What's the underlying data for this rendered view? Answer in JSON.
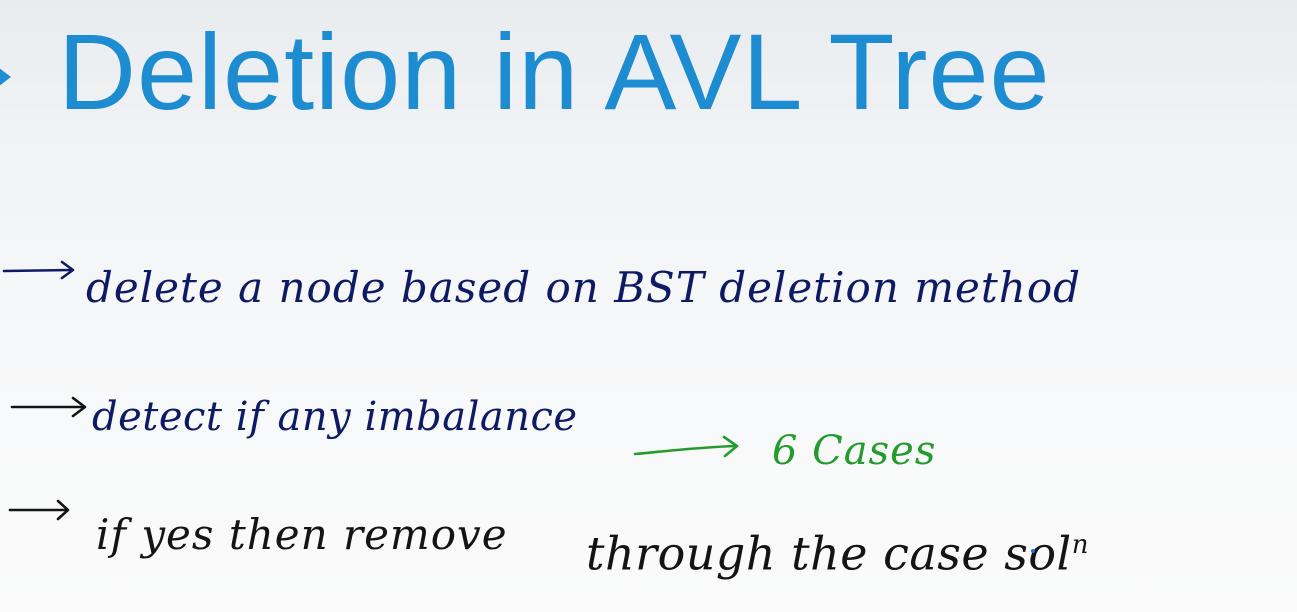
{
  "slide": {
    "title": "Deletion in AVL Tree",
    "title_color": "#1d8cd0",
    "bullet_marker": "triangle-right-icon"
  },
  "notes": [
    {
      "text": "delete  a node  based on  BST deletion  method",
      "color": "#0e1a63"
    },
    {
      "text": "detect  if  any  imbalance",
      "color": "#0e1a63"
    },
    {
      "text": "if  yes  then  remove",
      "color": "#141414"
    }
  ],
  "annotation": {
    "cases_text": "6  Cases",
    "color": "#249b2f"
  },
  "solution_note": {
    "text": "through the case sol",
    "superscript": "n",
    "color": "#141414"
  },
  "icons": [
    "arrow-right-icon",
    "triangle-right-icon"
  ]
}
